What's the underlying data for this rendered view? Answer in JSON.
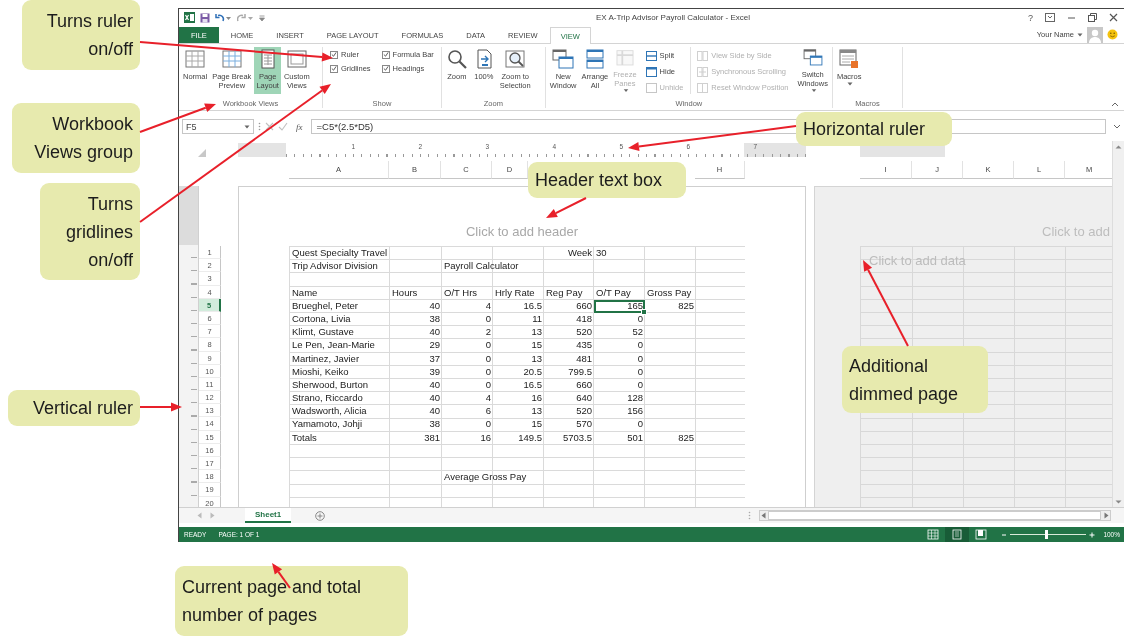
{
  "window": {
    "title": "EX A-Trip Advisor Payroll Calculator - Excel",
    "help": "?",
    "user": "Your Name"
  },
  "tabs": [
    {
      "label": "FILE",
      "kind": "backstage",
      "selected": false
    },
    {
      "label": "HOME",
      "kind": "tab",
      "selected": false
    },
    {
      "label": "INSERT",
      "kind": "tab",
      "selected": false
    },
    {
      "label": "PAGE LAYOUT",
      "kind": "tab",
      "selected": false
    },
    {
      "label": "FORMULAS",
      "kind": "tab",
      "selected": false
    },
    {
      "label": "DATA",
      "kind": "tab",
      "selected": false
    },
    {
      "label": "REVIEW",
      "kind": "tab",
      "selected": false
    },
    {
      "label": "VIEW",
      "kind": "tab",
      "selected": true
    }
  ],
  "ribbon": {
    "groups": [
      {
        "label": "Workbook Views",
        "items": [
          {
            "kind": "big",
            "lines": [
              "Normal"
            ],
            "selected": false,
            "disabled": false,
            "dropdown": false
          },
          {
            "kind": "big",
            "lines": [
              "Page Break",
              "Preview"
            ],
            "selected": false,
            "disabled": false,
            "dropdown": false
          },
          {
            "kind": "big",
            "lines": [
              "Page",
              "Layout"
            ],
            "selected": true,
            "disabled": false,
            "dropdown": false
          },
          {
            "kind": "big",
            "lines": [
              "Custom",
              "Views"
            ],
            "selected": false,
            "disabled": false,
            "dropdown": false
          }
        ]
      },
      {
        "label": "Show",
        "items": [
          {
            "kind": "check",
            "lines": [
              "Ruler"
            ],
            "checked": true
          },
          {
            "kind": "check",
            "lines": [
              "Gridlines"
            ],
            "checked": true
          },
          {
            "kind": "check",
            "lines": [
              "Formula Bar"
            ],
            "checked": true
          },
          {
            "kind": "check",
            "lines": [
              "Headings"
            ],
            "checked": true
          }
        ]
      },
      {
        "label": "Zoom",
        "items": [
          {
            "kind": "big",
            "lines": [
              "Zoom"
            ],
            "disabled": false,
            "dropdown": false
          },
          {
            "kind": "big",
            "lines": [
              "100%"
            ],
            "disabled": false,
            "dropdown": false
          },
          {
            "kind": "big",
            "lines": [
              "Zoom to",
              "Selection"
            ],
            "disabled": false,
            "dropdown": false
          }
        ]
      },
      {
        "label": "Window",
        "items": [
          {
            "kind": "big",
            "lines": [
              "New",
              "Window"
            ],
            "disabled": false,
            "dropdown": false
          },
          {
            "kind": "big",
            "lines": [
              "Arrange",
              "All"
            ],
            "disabled": false,
            "dropdown": false
          },
          {
            "kind": "big",
            "lines": [
              "Freeze",
              "Panes"
            ],
            "disabled": true,
            "dropdown": true
          },
          {
            "kind": "small",
            "lines": [
              "Split"
            ],
            "disabled": false
          },
          {
            "kind": "small",
            "lines": [
              "Hide"
            ],
            "disabled": false
          },
          {
            "kind": "small",
            "lines": [
              "Unhide"
            ],
            "disabled": true
          },
          {
            "kind": "small",
            "lines": [
              "View Side by Side"
            ],
            "disabled": true
          },
          {
            "kind": "small",
            "lines": [
              "Synchronous Scrolling"
            ],
            "disabled": true
          },
          {
            "kind": "small",
            "lines": [
              "Reset Window Position"
            ],
            "disabled": true
          },
          {
            "kind": "big",
            "lines": [
              "Switch",
              "Windows"
            ],
            "disabled": false,
            "dropdown": true
          }
        ]
      },
      {
        "label": "Macros",
        "items": [
          {
            "kind": "big",
            "lines": [
              "Macros"
            ],
            "disabled": false,
            "dropdown": true
          }
        ]
      }
    ]
  },
  "formula_bar": {
    "name_box": "F5",
    "function_label": "fx",
    "formula": "=C5*(2.5*D5)"
  },
  "sheet": {
    "ruler": [
      "1",
      "2",
      "3",
      "4",
      "5",
      "6",
      "7"
    ],
    "columns": [
      "A",
      "B",
      "C",
      "D",
      "H"
    ],
    "header_placeholder": "Click to add header",
    "rows": [
      {
        "header": "1",
        "selected": false,
        "cells": [
          {
            "kind": "text",
            "text": "Quest Specialty Travel",
            "selected": false
          },
          {
            "kind": "empty",
            "selected": false
          },
          {
            "kind": "empty",
            "selected": false
          },
          {
            "kind": "empty",
            "selected": false
          },
          {
            "kind": "number",
            "text": "Week",
            "selected": false
          },
          {
            "kind": "text",
            "text": "30",
            "selected": false
          },
          {
            "kind": "empty",
            "selected": false
          },
          {
            "kind": "empty",
            "selected": false
          }
        ]
      },
      {
        "header": "2",
        "selected": false,
        "cells": [
          {
            "kind": "text",
            "text": "Trip Advisor Division",
            "selected": false
          },
          {
            "kind": "empty",
            "selected": false
          },
          {
            "kind": "text",
            "text": "Payroll Calculator",
            "selected": false
          },
          {
            "kind": "empty",
            "selected": false
          },
          {
            "kind": "empty",
            "selected": false
          },
          {
            "kind": "empty",
            "selected": false
          },
          {
            "kind": "empty",
            "selected": false
          },
          {
            "kind": "empty",
            "selected": false
          }
        ]
      },
      {
        "header": "3",
        "selected": false,
        "cells": [
          {
            "kind": "empty",
            "selected": false
          },
          {
            "kind": "empty",
            "selected": false
          },
          {
            "kind": "empty",
            "selected": false
          },
          {
            "kind": "empty",
            "selected": false
          },
          {
            "kind": "empty",
            "selected": false
          },
          {
            "kind": "empty",
            "selected": false
          },
          {
            "kind": "empty",
            "selected": false
          },
          {
            "kind": "empty",
            "selected": false
          }
        ]
      },
      {
        "header": "4",
        "selected": false,
        "cells": [
          {
            "kind": "text",
            "text": "Name",
            "selected": false
          },
          {
            "kind": "text",
            "text": "Hours",
            "selected": false
          },
          {
            "kind": "text",
            "text": "O/T Hrs",
            "selected": false
          },
          {
            "kind": "text",
            "text": "Hrly Rate",
            "selected": false
          },
          {
            "kind": "text",
            "text": "Reg Pay",
            "selected": false
          },
          {
            "kind": "text",
            "text": "O/T Pay",
            "selected": false
          },
          {
            "kind": "text",
            "text": "Gross Pay",
            "selected": false
          },
          {
            "kind": "empty",
            "selected": false
          }
        ]
      },
      {
        "header": "5",
        "selected": true,
        "cells": [
          {
            "kind": "text",
            "text": "Brueghel, Peter",
            "selected": false
          },
          {
            "kind": "number",
            "text": "40",
            "selected": false
          },
          {
            "kind": "number",
            "text": "4",
            "selected": false
          },
          {
            "kind": "number",
            "text": "16.5",
            "selected": false
          },
          {
            "kind": "number",
            "text": "660",
            "selected": false
          },
          {
            "kind": "number",
            "text": "165",
            "selected": true
          },
          {
            "kind": "number",
            "text": "825",
            "selected": false
          },
          {
            "kind": "empty",
            "selected": false
          }
        ]
      },
      {
        "header": "6",
        "selected": false,
        "cells": [
          {
            "kind": "text",
            "text": "Cortona, Livia",
            "selected": false
          },
          {
            "kind": "number",
            "text": "38",
            "selected": false
          },
          {
            "kind": "number",
            "text": "0",
            "selected": false
          },
          {
            "kind": "number",
            "text": "11",
            "selected": false
          },
          {
            "kind": "number",
            "text": "418",
            "selected": false
          },
          {
            "kind": "number",
            "text": "0",
            "selected": false
          },
          {
            "kind": "empty",
            "selected": false
          },
          {
            "kind": "empty",
            "selected": false
          }
        ]
      },
      {
        "header": "7",
        "selected": false,
        "cells": [
          {
            "kind": "text",
            "text": "Klimt, Gustave",
            "selected": false
          },
          {
            "kind": "number",
            "text": "40",
            "selected": false
          },
          {
            "kind": "number",
            "text": "2",
            "selected": false
          },
          {
            "kind": "number",
            "text": "13",
            "selected": false
          },
          {
            "kind": "number",
            "text": "520",
            "selected": false
          },
          {
            "kind": "number",
            "text": "52",
            "selected": false
          },
          {
            "kind": "empty",
            "selected": false
          },
          {
            "kind": "empty",
            "selected": false
          }
        ]
      },
      {
        "header": "8",
        "selected": false,
        "cells": [
          {
            "kind": "text",
            "text": "Le Pen, Jean-Marie",
            "selected": false
          },
          {
            "kind": "number",
            "text": "29",
            "selected": false
          },
          {
            "kind": "number",
            "text": "0",
            "selected": false
          },
          {
            "kind": "number",
            "text": "15",
            "selected": false
          },
          {
            "kind": "number",
            "text": "435",
            "selected": false
          },
          {
            "kind": "number",
            "text": "0",
            "selected": false
          },
          {
            "kind": "empty",
            "selected": false
          },
          {
            "kind": "empty",
            "selected": false
          }
        ]
      },
      {
        "header": "9",
        "selected": false,
        "cells": [
          {
            "kind": "text",
            "text": "Martinez, Javier",
            "selected": false
          },
          {
            "kind": "number",
            "text": "37",
            "selected": false
          },
          {
            "kind": "number",
            "text": "0",
            "selected": false
          },
          {
            "kind": "number",
            "text": "13",
            "selected": false
          },
          {
            "kind": "number",
            "text": "481",
            "selected": false
          },
          {
            "kind": "number",
            "text": "0",
            "selected": false
          },
          {
            "kind": "empty",
            "selected": false
          },
          {
            "kind": "empty",
            "selected": false
          }
        ]
      },
      {
        "header": "10",
        "selected": false,
        "cells": [
          {
            "kind": "text",
            "text": "Mioshi, Keiko",
            "selected": false
          },
          {
            "kind": "number",
            "text": "39",
            "selected": false
          },
          {
            "kind": "number",
            "text": "0",
            "selected": false
          },
          {
            "kind": "number",
            "text": "20.5",
            "selected": false
          },
          {
            "kind": "number",
            "text": "799.5",
            "selected": false
          },
          {
            "kind": "number",
            "text": "0",
            "selected": false
          },
          {
            "kind": "empty",
            "selected": false
          },
          {
            "kind": "empty",
            "selected": false
          }
        ]
      },
      {
        "header": "11",
        "selected": false,
        "cells": [
          {
            "kind": "text",
            "text": "Sherwood, Burton",
            "selected": false
          },
          {
            "kind": "number",
            "text": "40",
            "selected": false
          },
          {
            "kind": "number",
            "text": "0",
            "selected": false
          },
          {
            "kind": "number",
            "text": "16.5",
            "selected": false
          },
          {
            "kind": "number",
            "text": "660",
            "selected": false
          },
          {
            "kind": "number",
            "text": "0",
            "selected": false
          },
          {
            "kind": "empty",
            "selected": false
          },
          {
            "kind": "empty",
            "selected": false
          }
        ]
      },
      {
        "header": "12",
        "selected": false,
        "cells": [
          {
            "kind": "text",
            "text": "Strano, Riccardo",
            "selected": false
          },
          {
            "kind": "number",
            "text": "40",
            "selected": false
          },
          {
            "kind": "number",
            "text": "4",
            "selected": false
          },
          {
            "kind": "number",
            "text": "16",
            "selected": false
          },
          {
            "kind": "number",
            "text": "640",
            "selected": false
          },
          {
            "kind": "number",
            "text": "128",
            "selected": false
          },
          {
            "kind": "empty",
            "selected": false
          },
          {
            "kind": "empty",
            "selected": false
          }
        ]
      },
      {
        "header": "13",
        "selected": false,
        "cells": [
          {
            "kind": "text",
            "text": "Wadsworth, Alicia",
            "selected": false
          },
          {
            "kind": "number",
            "text": "40",
            "selected": false
          },
          {
            "kind": "number",
            "text": "6",
            "selected": false
          },
          {
            "kind": "number",
            "text": "13",
            "selected": false
          },
          {
            "kind": "number",
            "text": "520",
            "selected": false
          },
          {
            "kind": "number",
            "text": "156",
            "selected": false
          },
          {
            "kind": "empty",
            "selected": false
          },
          {
            "kind": "empty",
            "selected": false
          }
        ]
      },
      {
        "header": "14",
        "selected": false,
        "cells": [
          {
            "kind": "text",
            "text": "Yamamoto, Johji",
            "selected": false
          },
          {
            "kind": "number",
            "text": "38",
            "selected": false
          },
          {
            "kind": "number",
            "text": "0",
            "selected": false
          },
          {
            "kind": "number",
            "text": "15",
            "selected": false
          },
          {
            "kind": "number",
            "text": "570",
            "selected": false
          },
          {
            "kind": "number",
            "text": "0",
            "selected": false
          },
          {
            "kind": "empty",
            "selected": false
          },
          {
            "kind": "empty",
            "selected": false
          }
        ]
      },
      {
        "header": "15",
        "selected": false,
        "cells": [
          {
            "kind": "text",
            "text": "Totals",
            "selected": false
          },
          {
            "kind": "number",
            "text": "381",
            "selected": false
          },
          {
            "kind": "number",
            "text": "16",
            "selected": false
          },
          {
            "kind": "number",
            "text": "149.5",
            "selected": false
          },
          {
            "kind": "number",
            "text": "5703.5",
            "selected": false
          },
          {
            "kind": "number",
            "text": "501",
            "selected": false
          },
          {
            "kind": "number",
            "text": "825",
            "selected": false
          },
          {
            "kind": "empty",
            "selected": false
          }
        ]
      },
      {
        "header": "16",
        "selected": false,
        "cells": [
          {
            "kind": "empty",
            "selected": false
          },
          {
            "kind": "empty",
            "selected": false
          },
          {
            "kind": "empty",
            "selected": false
          },
          {
            "kind": "empty",
            "selected": false
          },
          {
            "kind": "empty",
            "selected": false
          },
          {
            "kind": "empty",
            "selected": false
          },
          {
            "kind": "empty",
            "selected": false
          },
          {
            "kind": "empty",
            "selected": false
          }
        ]
      },
      {
        "header": "17",
        "selected": false,
        "cells": [
          {
            "kind": "empty",
            "selected": false
          },
          {
            "kind": "empty",
            "selected": false
          },
          {
            "kind": "empty",
            "selected": false
          },
          {
            "kind": "empty",
            "selected": false
          },
          {
            "kind": "empty",
            "selected": false
          },
          {
            "kind": "empty",
            "selected": false
          },
          {
            "kind": "empty",
            "selected": false
          },
          {
            "kind": "empty",
            "selected": false
          }
        ]
      },
      {
        "header": "18",
        "selected": false,
        "cells": [
          {
            "kind": "empty",
            "selected": false
          },
          {
            "kind": "empty",
            "selected": false
          },
          {
            "kind": "text",
            "text": "Average Gross Pay",
            "selected": false
          },
          {
            "kind": "empty",
            "selected": false
          },
          {
            "kind": "empty",
            "selected": false
          },
          {
            "kind": "empty",
            "selected": false
          },
          {
            "kind": "empty",
            "selected": false
          },
          {
            "kind": "empty",
            "selected": false
          }
        ]
      },
      {
        "header": "19",
        "selected": false,
        "cells": [
          {
            "kind": "empty",
            "selected": false
          },
          {
            "kind": "empty",
            "selected": false
          },
          {
            "kind": "empty",
            "selected": false
          },
          {
            "kind": "empty",
            "selected": false
          },
          {
            "kind": "empty",
            "selected": false
          },
          {
            "kind": "empty",
            "selected": false
          },
          {
            "kind": "empty",
            "selected": false
          },
          {
            "kind": "empty",
            "selected": false
          }
        ]
      },
      {
        "header": "20",
        "selected": false,
        "cells": [
          {
            "kind": "empty",
            "selected": false
          },
          {
            "kind": "empty",
            "selected": false
          },
          {
            "kind": "empty",
            "selected": false
          },
          {
            "kind": "empty",
            "selected": false
          },
          {
            "kind": "empty",
            "selected": false
          },
          {
            "kind": "empty",
            "selected": false
          },
          {
            "kind": "empty",
            "selected": false
          },
          {
            "kind": "empty",
            "selected": false
          }
        ]
      }
    ]
  },
  "dimmed_page": {
    "columns": [
      "I",
      "J",
      "K",
      "L",
      "M"
    ],
    "header_placeholder": "Click to add",
    "body_placeholder": "Click to add data"
  },
  "sheet_tabs": [
    {
      "label": "Sheet1",
      "selected": true
    }
  ],
  "status_bar": {
    "mode": "READY",
    "page": "PAGE: 1 OF 1",
    "views": [
      {
        "selected": false
      },
      {
        "selected": true
      },
      {
        "selected": false
      }
    ],
    "zoom": {
      "level": 0.47,
      "reading": "100%"
    }
  },
  "callouts": [
    {
      "lines": [
        "Turns ruler",
        "on/off"
      ]
    },
    {
      "lines": [
        "Workbook",
        "Views group"
      ]
    },
    {
      "lines": [
        "Turns",
        "gridlines",
        "on/off"
      ]
    },
    {
      "lines": [
        "Vertical ruler"
      ]
    },
    {
      "lines": [
        "Horizontal ruler"
      ]
    },
    {
      "lines": [
        "Header text box"
      ]
    },
    {
      "lines": [
        "Additional",
        "dimmed page"
      ]
    },
    {
      "lines": [
        "Current page and total",
        "number of pages"
      ]
    }
  ]
}
